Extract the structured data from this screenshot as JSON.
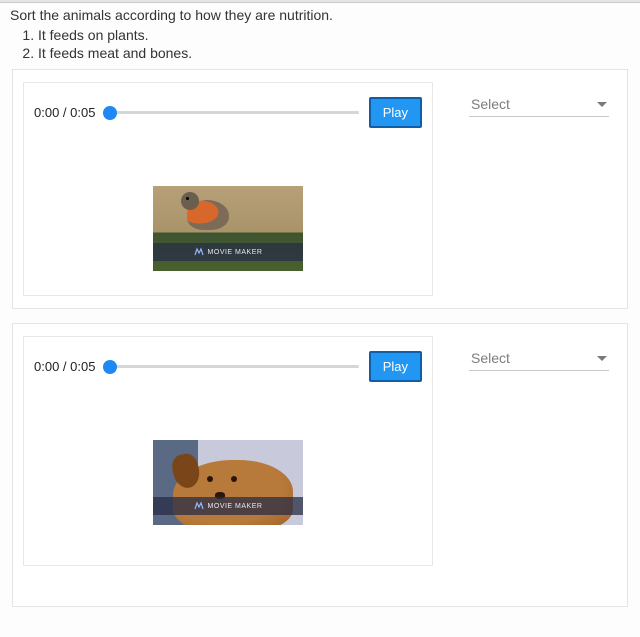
{
  "question": "Sort the animals according to how they are nutrition.",
  "options": [
    "It feeds on plants.",
    "It feeds meat and bones."
  ],
  "items": [
    {
      "time": "0:00 / 0:05",
      "play_label": "Play",
      "watermark": "MOVIE MAKER",
      "select_placeholder": "Select"
    },
    {
      "time": "0:00 / 0:05",
      "play_label": "Play",
      "watermark": "MOVIE MAKER",
      "select_placeholder": "Select"
    }
  ]
}
